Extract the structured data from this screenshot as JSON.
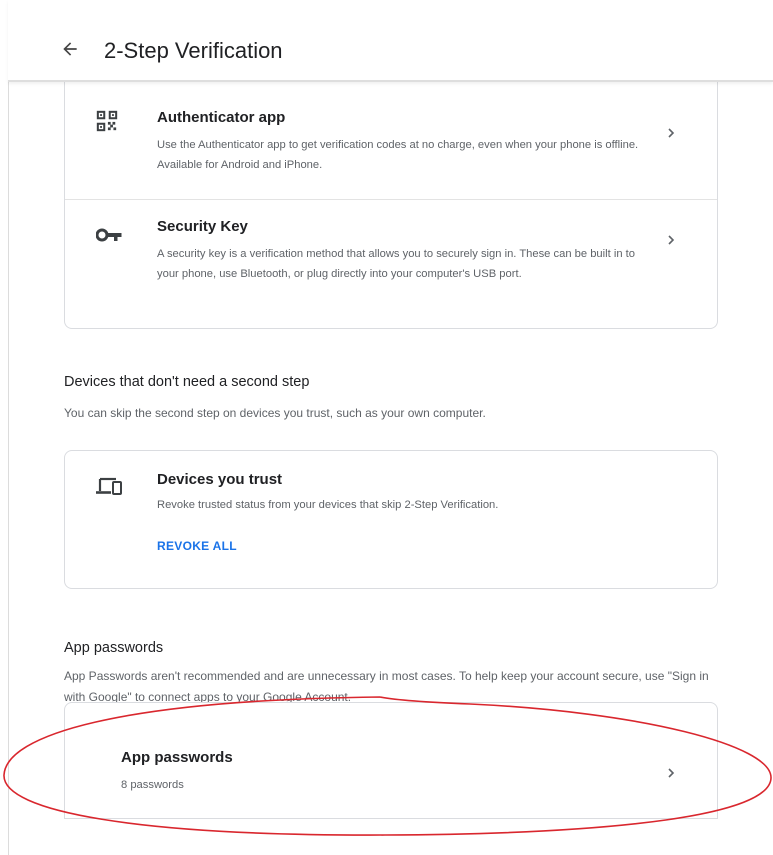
{
  "header": {
    "title": "2-Step Verification",
    "back_icon": "arrow-back-icon"
  },
  "methods": [
    {
      "icon": "qr-code-icon",
      "title": "Authenticator app",
      "description": "Use the Authenticator app to get verification codes at no charge, even when your phone is offline. Available for Android and iPhone."
    },
    {
      "icon": "key-icon",
      "title": "Security Key",
      "description": "A security key is a verification method that allows you to securely sign in. These can be built in to your phone, use Bluetooth, or plug directly into your computer's USB port."
    }
  ],
  "devices_section": {
    "title": "Devices that don't need a second step",
    "description": "You can skip the second step on devices you trust, such as your own computer.",
    "card": {
      "icon": "devices-icon",
      "title": "Devices you trust",
      "description": "Revoke trusted status from your devices that skip 2-Step Verification.",
      "action_label": "REVOKE ALL"
    }
  },
  "app_passwords_section": {
    "title": "App passwords",
    "description": "App Passwords aren't recommended and are unnecessary in most cases. To help keep your account secure, use \"Sign in with Google\" to connect apps to your Google Account.",
    "card": {
      "title": "App passwords",
      "subtitle": "8 passwords"
    }
  },
  "colors": {
    "link": "#1a73e8",
    "annotation": "#d9272e",
    "text_primary": "#202124",
    "text_secondary": "#5f6368"
  }
}
